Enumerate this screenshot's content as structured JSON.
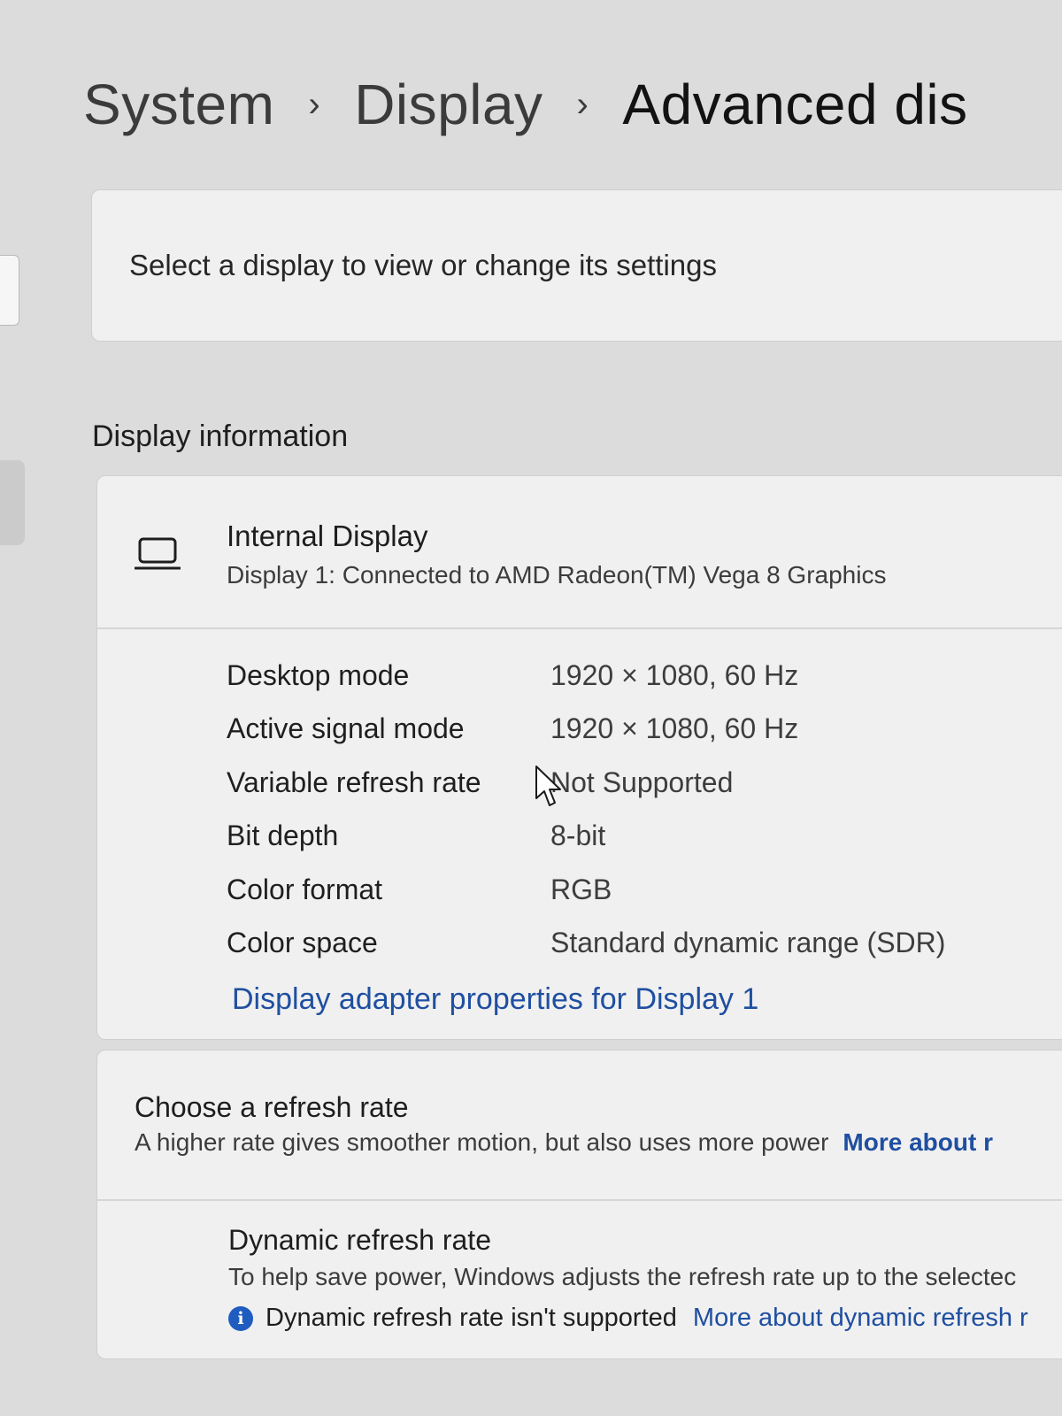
{
  "breadcrumb": {
    "items": [
      "System",
      "Display",
      "Advanced dis"
    ],
    "separator": "›"
  },
  "select_display": {
    "label": "Select a display to view or change its settings"
  },
  "display_information": {
    "heading": "Display information",
    "title": "Internal Display",
    "subtitle": "Display 1: Connected to AMD Radeon(TM) Vega 8 Graphics",
    "icon": "laptop-icon",
    "properties": [
      {
        "name": "Desktop mode",
        "value": "1920 × 1080, 60 Hz"
      },
      {
        "name": "Active signal mode",
        "value": "1920 × 1080, 60 Hz"
      },
      {
        "name": "Variable refresh rate",
        "value": "Not Supported"
      },
      {
        "name": "Bit depth",
        "value": "8-bit"
      },
      {
        "name": "Color format",
        "value": "RGB"
      },
      {
        "name": "Color space",
        "value": "Standard dynamic range (SDR)"
      }
    ],
    "adapter_link": "Display adapter properties for Display 1"
  },
  "refresh_rate": {
    "title": "Choose a refresh rate",
    "description": "A higher rate gives smoother motion, but also uses more power",
    "more_link": "More about r",
    "dynamic": {
      "title": "Dynamic refresh rate",
      "description": "To help save power, Windows adjusts the refresh rate up to the selectec",
      "note": "Dynamic refresh rate isn't supported",
      "note_icon": "info-icon",
      "link": "More about dynamic refresh r"
    }
  },
  "colors": {
    "background": "#dcdcdc",
    "card": "#f0f0f0",
    "link": "#1f4fa0",
    "info_icon": "#1f5cc0"
  }
}
